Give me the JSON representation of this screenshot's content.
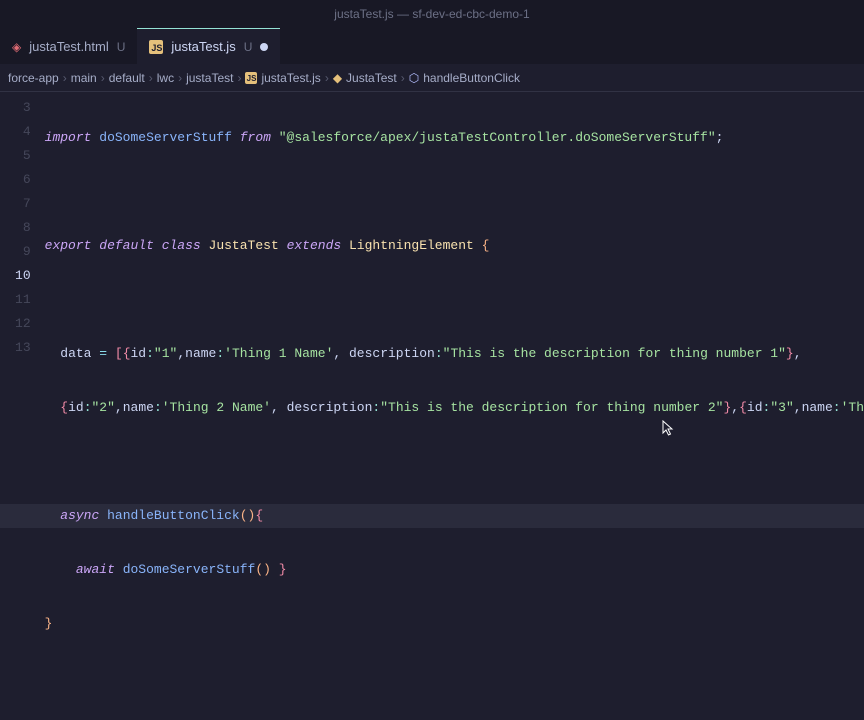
{
  "title": "justaTest.js — sf-dev-ed-cbc-demo-1",
  "tabs": [
    {
      "label": "justaTest.html",
      "mod": "U",
      "icon": "html",
      "active": false,
      "dirty": false
    },
    {
      "label": "justaTest.js",
      "mod": "U",
      "icon": "js",
      "active": true,
      "dirty": true
    }
  ],
  "breadcrumbs": {
    "parts": [
      "force-app",
      "main",
      "default",
      "lwc",
      "justaTest"
    ],
    "file": "justaTest.js",
    "class": "JustaTest",
    "method": "handleButtonClick"
  },
  "lineNumbers": [
    "3",
    "4",
    "5",
    "6",
    "7",
    "8",
    "9",
    "10",
    "11",
    "12",
    "13"
  ],
  "currentLine": "10",
  "code": {
    "l3": {
      "import": "import",
      "ident": "doSomeServerStuff",
      "from": "from",
      "str": "\"@salesforce/apex/justaTestController.doSomeServerStuff\"",
      "semi": ";"
    },
    "l5": {
      "export": "export",
      "default": "default",
      "class": "class",
      "name": "JustaTest",
      "extends": "extends",
      "base": "LightningElement",
      "brace": "{"
    },
    "l7": {
      "data": "data",
      "eq": " = ",
      "open": "[{",
      "id": "id",
      "c1": ":",
      "v1": "\"1\"",
      "comma1": ",",
      "name": "name",
      "c2": ":",
      "v2": "'Thing 1 Name'",
      "comma2": ", ",
      "desc": "description",
      "c3": ":",
      "v3": "\"This is the description for thing number 1\"",
      "close": "}",
      "trail": ","
    },
    "l8": {
      "open": "{",
      "id": "id",
      "c1": ":",
      "v1": "\"2\"",
      "comma1": ",",
      "name": "name",
      "c2": ":",
      "v2": "'Thing 2 Name'",
      "comma2": ", ",
      "desc": "description",
      "c3": ":",
      "v3": "\"This is the description for thing number 2\"",
      "close": "}",
      "comma3": ",",
      "open2": "{",
      "id2": "id",
      "c4": ":",
      "v4": "\"3\"",
      "comma4": ",",
      "name2": "name",
      "c5": ":",
      "v5": "'Th"
    },
    "l10": {
      "async": "async",
      "fn": "handleButtonClick",
      "parens": "()",
      "brace": "{"
    },
    "l11": {
      "await": "await",
      "fn": "doSomeServerStuff",
      "parens": "()",
      "close": " }"
    },
    "l12": {
      "brace": "}"
    }
  }
}
